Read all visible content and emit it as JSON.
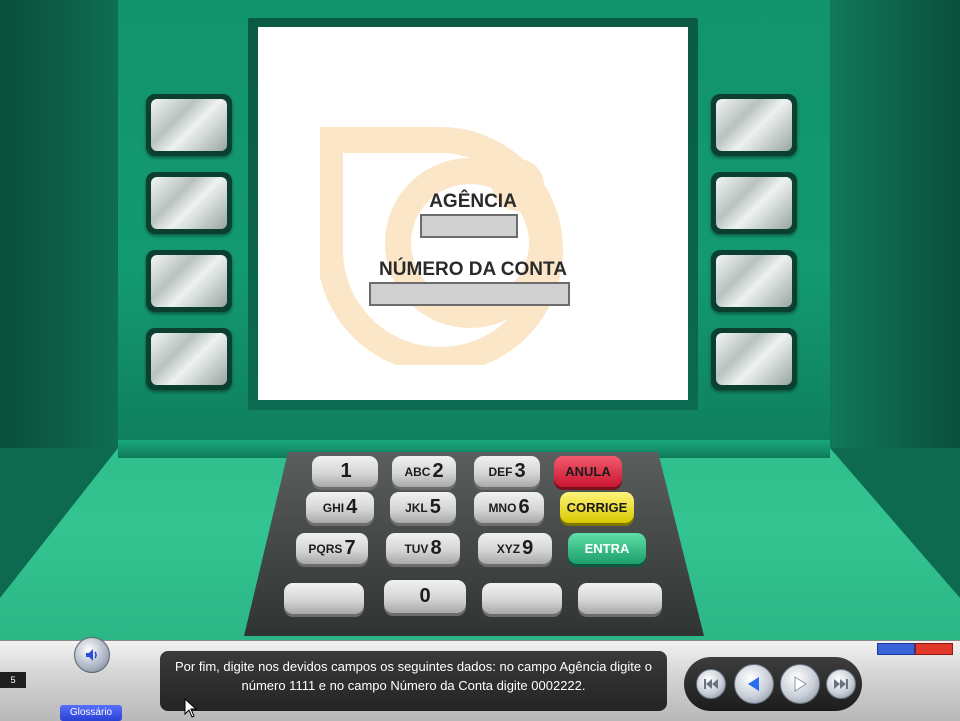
{
  "screen": {
    "agencia_label": "AGÊNCIA",
    "agencia_value": "",
    "conta_label": "NÚMERO DA CONTA",
    "conta_value": ""
  },
  "keypad": {
    "row1": [
      {
        "letters": "",
        "digit": "1"
      },
      {
        "letters": "ABC",
        "digit": "2"
      },
      {
        "letters": "DEF",
        "digit": "3"
      }
    ],
    "row2": [
      {
        "letters": "GHI",
        "digit": "4"
      },
      {
        "letters": "JKL",
        "digit": "5"
      },
      {
        "letters": "MNO",
        "digit": "6"
      }
    ],
    "row3": [
      {
        "letters": "PQRS",
        "digit": "7"
      },
      {
        "letters": "TUV",
        "digit": "8"
      },
      {
        "letters": "XYZ",
        "digit": "9"
      }
    ],
    "zero": "0",
    "anula": "ANULA",
    "corrige": "CORRIGE",
    "entra": "ENTRA"
  },
  "player": {
    "page_number": "5",
    "glossary_label": "Glossário",
    "caption": "Por fim, digite nos devidos campos os seguintes dados: no campo Agência digite o número 1111 e no campo Número da Conta digite 0002222."
  },
  "colors": {
    "atm_green": "#13946c",
    "anula_red": "#d9223b",
    "corrige_yellow": "#f0e100",
    "entra_green": "#2bbf85"
  },
  "icons": {
    "audio": "speaker-icon",
    "first": "skip-first-icon",
    "back": "play-back-icon",
    "forward": "play-forward-icon",
    "last": "skip-last-icon"
  }
}
